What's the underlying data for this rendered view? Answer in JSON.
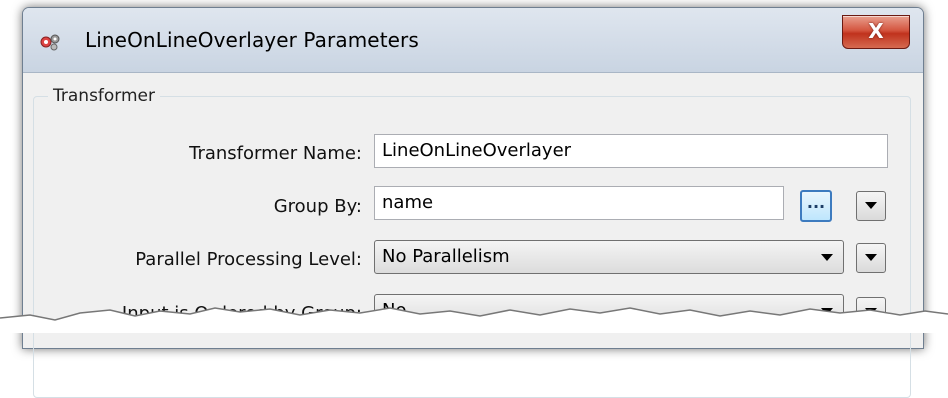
{
  "window": {
    "title": "LineOnLineOverlayer Parameters",
    "close_label": "X"
  },
  "group": {
    "legend": "Transformer"
  },
  "fields": {
    "transformer_name": {
      "label": "Transformer Name:",
      "value": "LineOnLineOverlayer"
    },
    "group_by": {
      "label": "Group By:",
      "value": "name",
      "ellipsis_label": "..."
    },
    "parallel_processing": {
      "label": "Parallel Processing Level:",
      "value": "No Parallelism"
    },
    "input_ordered": {
      "label": "Input is Ordered by Group:",
      "value": "No"
    }
  },
  "icons": {
    "app": "transformer-gears-icon",
    "dropdown": "chevron-down-icon"
  },
  "colors": {
    "titlebar": "#d3dce8",
    "close_button": "#c7402a",
    "accent_button": "#3d7bbf"
  }
}
